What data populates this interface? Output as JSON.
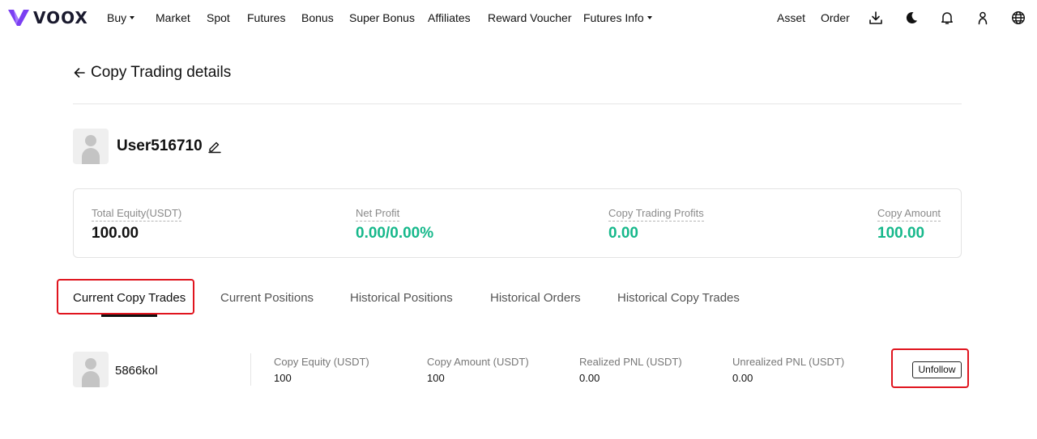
{
  "brand": {
    "name": "VOOX",
    "accent": "#7b3ff2",
    "positive_color": "#16b88b",
    "highlight_color": "#e0141e"
  },
  "nav": {
    "items": [
      {
        "label": "Buy",
        "dropdown": true
      },
      {
        "label": "Market"
      },
      {
        "label": "Spot"
      },
      {
        "label": "Futures"
      },
      {
        "label": "Bonus"
      },
      {
        "label": "Super Bonus"
      },
      {
        "label": "Affiliates"
      },
      {
        "label": "Reward Voucher"
      },
      {
        "label": "Futures Info",
        "dropdown": true
      }
    ],
    "right": {
      "asset": "Asset",
      "order": "Order",
      "icons": [
        "download-icon",
        "moon-icon",
        "bell-icon",
        "user-icon",
        "globe-icon"
      ]
    }
  },
  "page": {
    "title": "Copy Trading details",
    "back_icon": "arrow-left-icon"
  },
  "user": {
    "name": "User516710",
    "edit_icon": "pencil-icon"
  },
  "stats": [
    {
      "label": "Total Equity(USDT)",
      "value": "100.00",
      "positive": false
    },
    {
      "label": "Net Profit",
      "value": "0.00/0.00%",
      "positive": true
    },
    {
      "label": "Copy Trading Profits",
      "value": "0.00",
      "positive": true
    },
    {
      "label": "Copy Amount",
      "value": "100.00",
      "positive": true
    }
  ],
  "tabs": [
    {
      "label": "Current Copy Trades",
      "active": true
    },
    {
      "label": "Current Positions",
      "active": false
    },
    {
      "label": "Historical Positions",
      "active": false
    },
    {
      "label": "Historical Orders",
      "active": false
    },
    {
      "label": "Historical Copy Trades",
      "active": false
    }
  ],
  "trades": [
    {
      "trader": "5866kol",
      "columns": [
        {
          "label": "Copy Equity (USDT)",
          "value": "100"
        },
        {
          "label": "Copy Amount (USDT)",
          "value": "100"
        },
        {
          "label": "Realized PNL (USDT)",
          "value": "0.00"
        },
        {
          "label": "Unrealized PNL (USDT)",
          "value": "0.00"
        }
      ],
      "action": "Unfollow"
    }
  ]
}
